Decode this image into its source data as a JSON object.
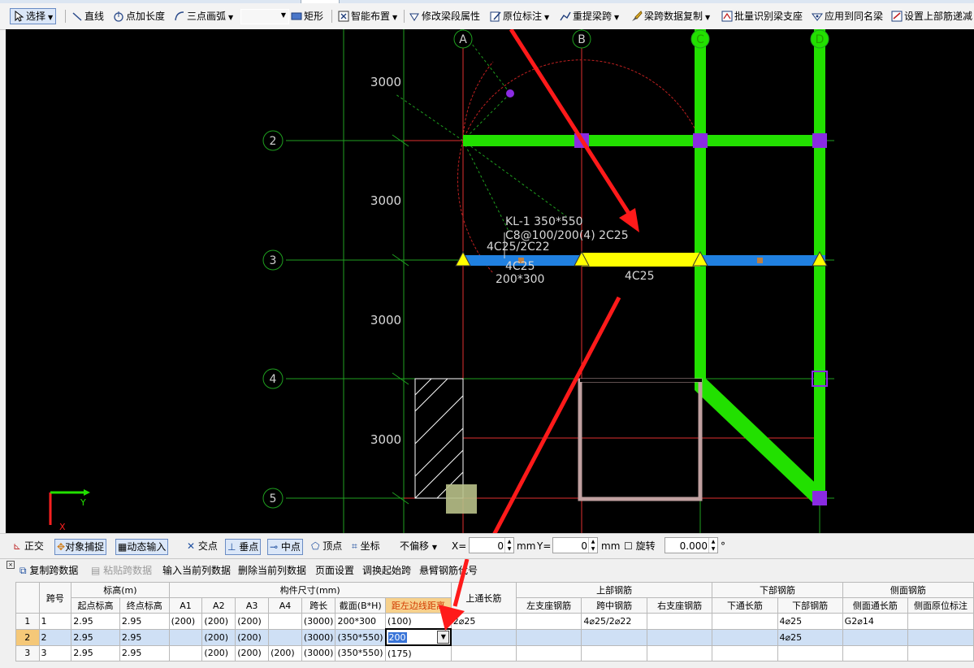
{
  "toolbar": {
    "items": [
      "选择",
      "直线",
      "点加长度",
      "三点画弧",
      "矩形",
      "智能布置",
      "修改梁段属性",
      "原位标注",
      "重提梁跨",
      "梁跨数据复制",
      "批量识别梁支座",
      "应用到同名梁",
      "设置上部筋递减"
    ]
  },
  "canvas": {
    "axis_cols": [
      "A",
      "B",
      "C",
      "D"
    ],
    "axis_rows": [
      "2",
      "3",
      "4",
      "5"
    ],
    "dims": [
      "3000",
      "3000",
      "3000",
      "3000"
    ],
    "beam_label_1": "KL-1 350*550",
    "beam_label_2": "C8@100/200(4) 2C25",
    "beam_label_3": "4C25/2C22",
    "beam_label_4": "4C25",
    "beam_label_5": "200*300",
    "beam_label_6": "4C25",
    "ucs_y": "Y",
    "ucs_x": "X"
  },
  "snapbar": {
    "items": [
      "正交",
      "对象捕捉",
      "动态输入",
      "交点",
      "垂点",
      "中点",
      "顶点",
      "坐标",
      "不偏移"
    ],
    "x_label": "X=",
    "x_value": "0",
    "x_unit": "mm",
    "y_label": "Y=",
    "y_value": "0",
    "y_unit": "mm",
    "rotate_label": "旋转",
    "rotate_value": "0.000",
    "deg": "°"
  },
  "panel": {
    "toolbar": [
      "复制跨数据",
      "粘贴跨数据",
      "输入当前列数据",
      "删除当前列数据",
      "页面设置",
      "调换起始跨",
      "悬臂钢筋代号"
    ],
    "headers_top": [
      "跨号",
      "标高(m)",
      "构件尺寸(mm)",
      "上通长筋",
      "上部钢筋",
      "下部钢筋",
      "侧面钢筋"
    ],
    "headers_sub": [
      "起点标高",
      "终点标高",
      "A1",
      "A2",
      "A3",
      "A4",
      "跨长",
      "截面(B*H)",
      "距左边线距离",
      "左支座钢筋",
      "跨中钢筋",
      "右支座钢筋",
      "下通长筋",
      "下部钢筋",
      "侧面通长筋",
      "侧面原位标注"
    ],
    "rows": [
      {
        "rn": "1",
        "span": "1",
        "z1": "2.95",
        "z2": "2.95",
        "a1": "(200)",
        "a2": "(200)",
        "a3": "(200)",
        "a4": "",
        "len": "(3000)",
        "sec": "200*300",
        "dist": "(100)",
        "top_cont": "2⌀25",
        "left_sup": "",
        "mid": "4⌀25/2⌀22",
        "right_sup": "",
        "bot_cont": "",
        "bot": "4⌀25",
        "side_cont": "G2⌀14",
        "side_orig": ""
      },
      {
        "rn": "2",
        "span": "2",
        "z1": "2.95",
        "z2": "2.95",
        "a1": "",
        "a2": "(200)",
        "a3": "(200)",
        "a4": "",
        "len": "(3000)",
        "sec": "(350*550)",
        "dist": "200",
        "top_cont": "",
        "left_sup": "",
        "mid": "",
        "right_sup": "",
        "bot_cont": "",
        "bot": "4⌀25",
        "side_cont": "",
        "side_orig": ""
      },
      {
        "rn": "3",
        "span": "3",
        "z1": "2.95",
        "z2": "2.95",
        "a1": "",
        "a2": "(200)",
        "a3": "(200)",
        "a4": "(200)",
        "len": "(3000)",
        "sec": "(350*550)",
        "dist": "(175)",
        "top_cont": "",
        "left_sup": "",
        "mid": "",
        "right_sup": "",
        "bot_cont": "",
        "bot": "",
        "side_cont": "",
        "side_orig": ""
      }
    ]
  },
  "colors": {
    "beam_green": "#22e000",
    "beam_blue": "#2080e0",
    "beam_yellow": "#ffff00",
    "axis_red": "#e03030",
    "axis_green": "#1fa01f",
    "arrow_red": "#ff1a1a",
    "column_purple": "#8a2be2"
  }
}
